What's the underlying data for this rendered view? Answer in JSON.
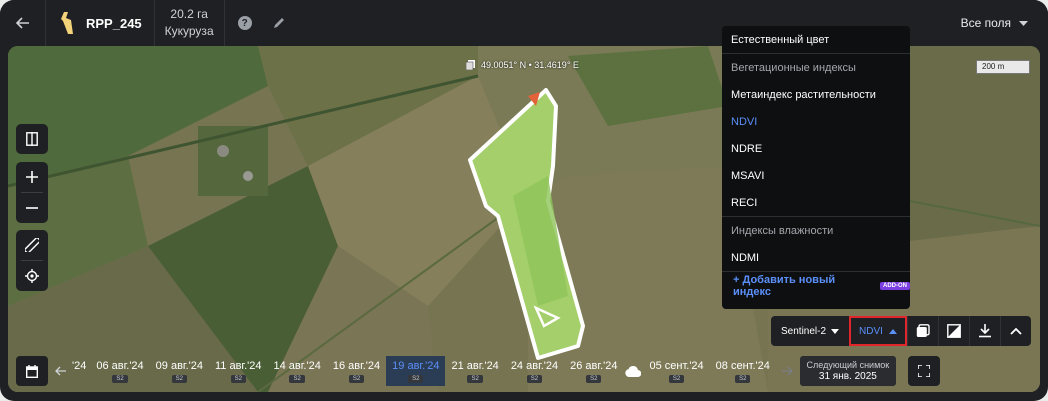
{
  "header": {
    "field_name": "RPP_245",
    "area": "20.2 га",
    "crop": "Кукуруза",
    "help_label": "?",
    "all_fields": "Все поля"
  },
  "map": {
    "coordinates": "49.0051° N • 31.4619° E",
    "scale": "200 m"
  },
  "dropdown": {
    "items": [
      {
        "type": "item",
        "label": "Естественный цвет"
      },
      {
        "type": "group",
        "label": "Вегетационные индексы"
      },
      {
        "type": "item",
        "label": "Метаиндекс растительности"
      },
      {
        "type": "item",
        "label": "NDVI",
        "active": true
      },
      {
        "type": "item",
        "label": "NDRE"
      },
      {
        "type": "item",
        "label": "MSAVI"
      },
      {
        "type": "item",
        "label": "RECI"
      },
      {
        "type": "group",
        "label": "Индексы влажности"
      },
      {
        "type": "item",
        "label": "NDMI"
      }
    ],
    "add_label": "+ Добавить новый индекс",
    "add_badge": "ADD-ON"
  },
  "toolbar": {
    "satellite": "Sentinel-2",
    "index": "NDVI"
  },
  "timeline": {
    "dates": [
      {
        "date": "'24",
        "source": ""
      },
      {
        "date": "06 авг.'24",
        "source": "S2"
      },
      {
        "date": "09 авг.'24",
        "source": "S2"
      },
      {
        "date": "11 авг.'24",
        "source": "S2"
      },
      {
        "date": "14 авг.'24",
        "source": "S2"
      },
      {
        "date": "16 авг.'24",
        "source": "S2"
      },
      {
        "date": "19 авг.'24",
        "source": "S2",
        "active": true
      },
      {
        "date": "21 авг.'24",
        "source": "S2"
      },
      {
        "date": "24 авг.'24",
        "source": "S2"
      },
      {
        "date": "26 авг.'24",
        "source": "S2"
      },
      {
        "date": "05 сент.'24",
        "source": "S2",
        "cloud": true
      },
      {
        "date": "08 сент.'24",
        "source": "S2"
      }
    ],
    "next_label": "Следующий снимок",
    "next_date": "31 янв. 2025"
  },
  "colors": {
    "accent": "#5b8ff9",
    "highlight": "#e0262b",
    "panel": "#1e2023"
  }
}
